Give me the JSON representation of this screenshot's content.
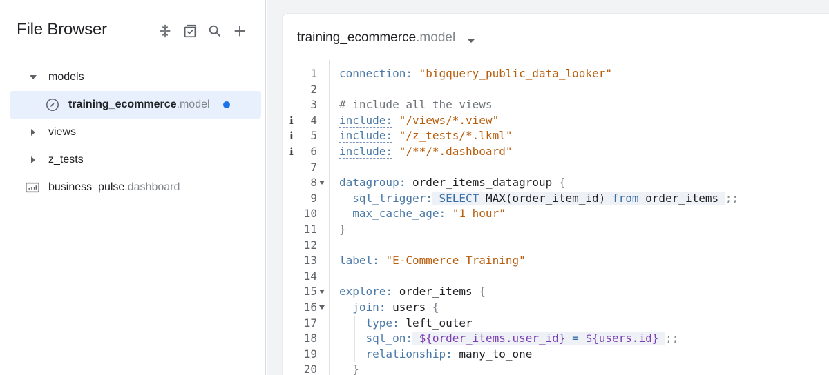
{
  "sidebar": {
    "title": "File Browser",
    "tools": [
      {
        "name": "collapse-all-icon"
      },
      {
        "name": "validate-icon"
      },
      {
        "name": "search-icon"
      },
      {
        "name": "add-icon"
      }
    ],
    "tree": [
      {
        "label": "models",
        "ext": "",
        "type": "folder",
        "expanded": true,
        "depth": 0
      },
      {
        "label": "training_ecommerce",
        "ext": ".model",
        "type": "model-file",
        "selected": true,
        "unsaved": true,
        "depth": 1
      },
      {
        "label": "views",
        "ext": "",
        "type": "folder",
        "expanded": false,
        "depth": 0
      },
      {
        "label": "z_tests",
        "ext": "",
        "type": "folder",
        "expanded": false,
        "depth": 0
      },
      {
        "label": "business_pulse",
        "ext": ".dashboard",
        "type": "dashboard-file",
        "depth": 0
      }
    ]
  },
  "editor": {
    "file_name": "training_ecommerce",
    "file_ext": ".model",
    "line_numbers": [
      "1",
      "2",
      "3",
      "4",
      "5",
      "6",
      "7",
      "8",
      "9",
      "10",
      "11",
      "12",
      "13",
      "14",
      "15",
      "16",
      "17",
      "18",
      "19",
      "20"
    ],
    "lines": {
      "l1": {
        "key": "connection:",
        "val": "\"bigquery_public_data_looker\""
      },
      "l3": {
        "comment": "# include all the views"
      },
      "l4": {
        "key": "include:",
        "val": "\"/views/*.view\""
      },
      "l5": {
        "key": "include:",
        "val": "\"/z_tests/*.lkml\""
      },
      "l6": {
        "key": "include:",
        "val": "\"/**/*.dashboard\""
      },
      "l8": {
        "key": "datagroup:",
        "name": "order_items_datagroup",
        "brace": "{"
      },
      "l9": {
        "key": "sql_trigger:",
        "sql1": "SELECT",
        "sql2": "MAX(order_item_id)",
        "sql3": "from",
        "sql4": "order_items",
        "end": ";;"
      },
      "l10": {
        "key": "max_cache_age:",
        "val": "\"1 hour\""
      },
      "l11": {
        "brace": "}"
      },
      "l13": {
        "key": "label:",
        "val": "\"E-Commerce Training\""
      },
      "l15": {
        "key": "explore:",
        "name": "order_items",
        "brace": "{"
      },
      "l16": {
        "key": "join:",
        "name": "users",
        "brace": "{"
      },
      "l17": {
        "key": "type:",
        "name": "left_outer"
      },
      "l18": {
        "key": "sql_on:",
        "v1": "${order_items.user_id}",
        "eq": "=",
        "v2": "${users.id}",
        "end": ";;"
      },
      "l19": {
        "key": "relationship:",
        "name": "many_to_one"
      },
      "l20": {
        "brace": "}"
      }
    },
    "info_marker": "i"
  },
  "colors": {
    "accent": "#1a73e8",
    "selected_bg": "#e8f0fe",
    "keyword": "#4a79a8",
    "string": "#b85d0c",
    "variable": "#7b3fb2"
  }
}
